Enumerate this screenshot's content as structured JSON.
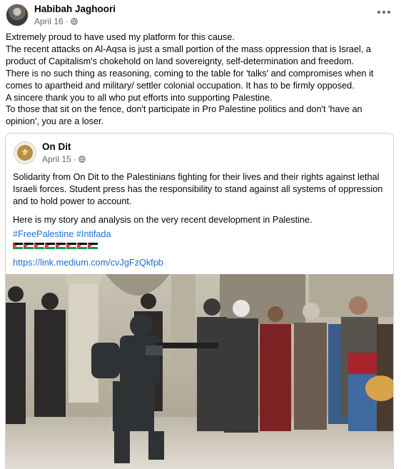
{
  "post": {
    "author": "Habibah Jaghoori",
    "date": "April 16",
    "date_separator": "·",
    "privacy_icon": "globe-icon",
    "more_icon": "more-horizontal-icon",
    "lines": [
      "Extremely proud to have used my platform for this cause.",
      "The recent attacks on Al-Aqsa is just a small portion of the mass oppression that is Israel, a",
      "product of Capitalism's chokehold on land sovereignty, self-determination and freedom.",
      "There is no such thing as reasoning, coming to the table for 'talks' and compromises when it",
      "comes to apartheid and military/ settler colonial occupation. It has to be firmly opposed.",
      "A sincere thank you to all who put efforts into supporting Palestine.",
      "To those that sit on the fence, don't participate in Pro Palestine politics and don't 'have an",
      "opinion', you are a loser."
    ]
  },
  "shared": {
    "author": "On Dit",
    "date": "April 15",
    "date_separator": "·",
    "privacy_icon": "globe-icon",
    "paragraph1_lines": [
      "Solidarity from On Dit to the Palestinians fighting for their lives and their rights against lethal",
      "Israeli forces. Student press has the responsibility to stand against all systems of oppression",
      "and to hold power to account."
    ],
    "paragraph2": "Here is my story and analysis on the very recent development in Palestine.",
    "hashtags": [
      "#FreePalestine",
      "#Intifada"
    ],
    "flag_emoji": "palestine-flag-icon",
    "flag_count": 8,
    "link": "https://link.medium.com/cvJgFzQkfpb",
    "photo": "Photo of an armed officer confronting a crowd of protesters at Al-Aqsa"
  }
}
